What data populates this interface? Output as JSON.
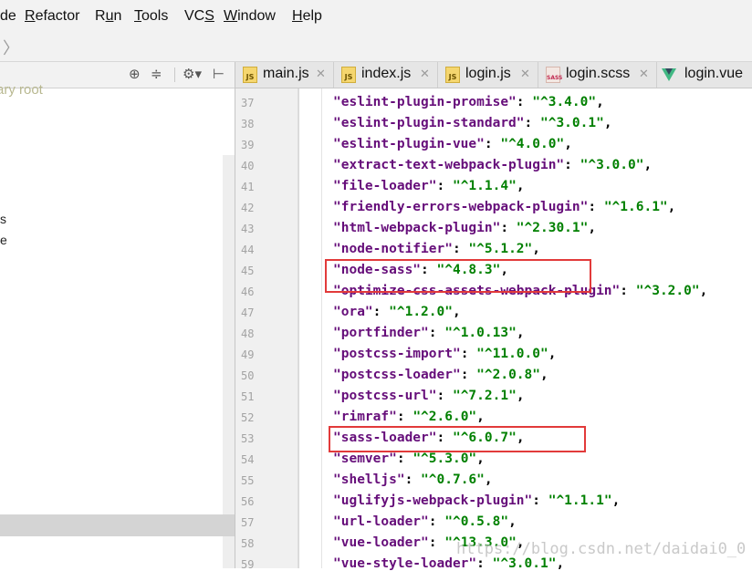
{
  "menu": {
    "items": [
      {
        "label": "de",
        "underline": ""
      },
      {
        "label": "Refactor",
        "underline": "R"
      },
      {
        "label": "Run",
        "underline": "u"
      },
      {
        "label": "Tools",
        "underline": "T"
      },
      {
        "label": "VCS",
        "underline": "S"
      },
      {
        "label": "Window",
        "underline": "W"
      },
      {
        "label": "Help",
        "underline": "H"
      }
    ]
  },
  "nav": {
    "chevron": "〉"
  },
  "project_panel": {
    "toolbar_icons": [
      "target-icon",
      "collapse-icon",
      "gear-icon",
      "hide-panel-icon"
    ],
    "root_label": "ary root",
    "partial_items": [
      "s",
      "e"
    ]
  },
  "tabs": [
    {
      "label": "main.js",
      "icon": "JS",
      "type": "js"
    },
    {
      "label": "index.js",
      "icon": "JS",
      "type": "js"
    },
    {
      "label": "login.js",
      "icon": "JS",
      "type": "js"
    },
    {
      "label": "login.scss",
      "icon": "SASS",
      "type": "sass"
    },
    {
      "label": "login.vue",
      "icon": "",
      "type": "vue"
    }
  ],
  "editor": {
    "lines": [
      {
        "num": "37",
        "key": "\"eslint-plugin-promise\"",
        "val": "\"^3.4.0\""
      },
      {
        "num": "38",
        "key": "\"eslint-plugin-standard\"",
        "val": "\"^3.0.1\""
      },
      {
        "num": "39",
        "key": "\"eslint-plugin-vue\"",
        "val": "\"^4.0.0\""
      },
      {
        "num": "40",
        "key": "\"extract-text-webpack-plugin\"",
        "val": "\"^3.0.0\""
      },
      {
        "num": "41",
        "key": "\"file-loader\"",
        "val": "\"^1.1.4\""
      },
      {
        "num": "42",
        "key": "\"friendly-errors-webpack-plugin\"",
        "val": "\"^1.6.1\""
      },
      {
        "num": "43",
        "key": "\"html-webpack-plugin\"",
        "val": "\"^2.30.1\""
      },
      {
        "num": "44",
        "key": "\"node-notifier\"",
        "val": "\"^5.1.2\""
      },
      {
        "num": "45",
        "key": "\"node-sass\"",
        "val": "\"^4.8.3\""
      },
      {
        "num": "46",
        "key": "\"optimize-css-assets-webpack-plugin\"",
        "val": "\"^3.2.0\""
      },
      {
        "num": "47",
        "key": "\"ora\"",
        "val": "\"^1.2.0\""
      },
      {
        "num": "48",
        "key": "\"portfinder\"",
        "val": "\"^1.0.13\""
      },
      {
        "num": "49",
        "key": "\"postcss-import\"",
        "val": "\"^11.0.0\""
      },
      {
        "num": "50",
        "key": "\"postcss-loader\"",
        "val": "\"^2.0.8\""
      },
      {
        "num": "51",
        "key": "\"postcss-url\"",
        "val": "\"^7.2.1\""
      },
      {
        "num": "52",
        "key": "\"rimraf\"",
        "val": "\"^2.6.0\""
      },
      {
        "num": "53",
        "key": "\"sass-loader\"",
        "val": "\"^6.0.7\""
      },
      {
        "num": "54",
        "key": "\"semver\"",
        "val": "\"^5.3.0\""
      },
      {
        "num": "55",
        "key": "\"shelljs\"",
        "val": "\"^0.7.6\""
      },
      {
        "num": "56",
        "key": "\"uglifyjs-webpack-plugin\"",
        "val": "\"^1.1.1\""
      },
      {
        "num": "57",
        "key": "\"url-loader\"",
        "val": "\"^0.5.8\""
      },
      {
        "num": "58",
        "key": "\"vue-loader\"",
        "val": "\"^13.3.0\""
      },
      {
        "num": "59",
        "key": "\"vue-style-loader\"",
        "val": "\"^3.0.1\""
      }
    ],
    "highlighted_lines": [
      "45",
      "53"
    ],
    "highlight_color": "#e23a3a",
    "key_color": "#660e7a",
    "value_color": "#008000"
  },
  "watermark": "https://blog.csdn.net/daidai0_0"
}
